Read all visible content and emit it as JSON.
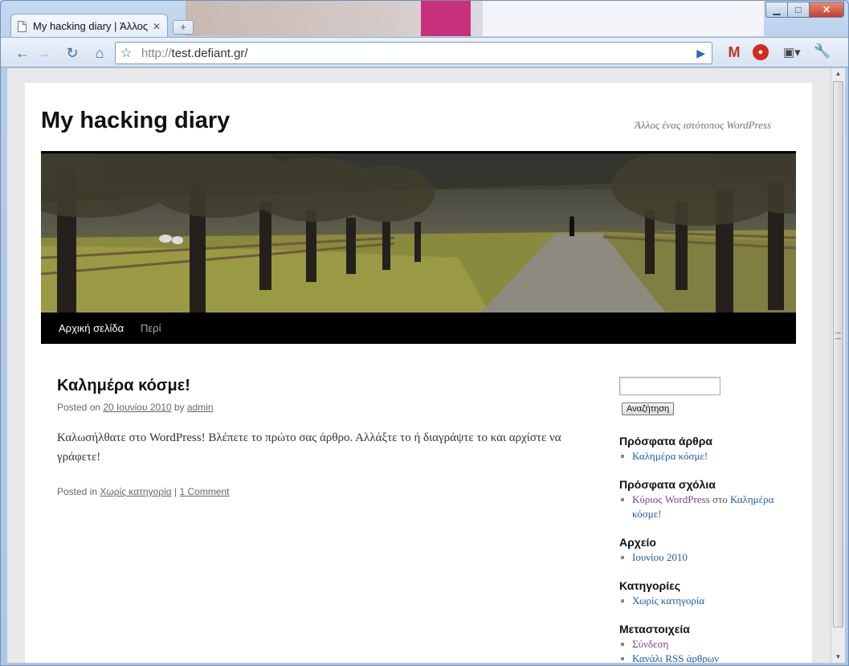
{
  "browser": {
    "tab_title": "My hacking diary | Άλλος...",
    "tab_close": "✕",
    "newtab": "+",
    "url_prefix": "http://",
    "url_host": "test.defiant.gr/",
    "window_buttons": {
      "minimize": "▁",
      "maximize": "□",
      "close": "✕"
    }
  },
  "site": {
    "title": "My hacking diary",
    "tagline": "Άλλος ένας ιστότοπος WordPress",
    "nav": [
      "Αρχική σελίδα",
      "Περί"
    ]
  },
  "post": {
    "title": "Καλημέρα κόσμε!",
    "meta_posted_on": "Posted on ",
    "meta_date": "20 Ιουνίου 2010",
    "meta_by": " by ",
    "meta_author": "admin",
    "content": "Καλωσήλθατε στο WordPress! Βλέπετε το πρώτο σας άρθρο. Αλλάξτε το ή διαγράψτε το και αρχίστε να γράφετε!",
    "footer_posted_in": "Posted in ",
    "footer_category": "Χωρίς κατηγορία",
    "footer_sep": " | ",
    "footer_comments": "1 Comment"
  },
  "sidebar": {
    "search_button": "Αναζήτηση",
    "recent_posts_title": "Πρόσφατα άρθρα",
    "recent_post_1": "Καλημέρα κόσμε!",
    "recent_comments_title": "Πρόσφατα σχόλια",
    "recent_comment_author": "Κύριος WordPress",
    "recent_comment_on": " στο ",
    "recent_comment_post": "Καλημέρα κόσμε!",
    "archives_title": "Αρχείο",
    "archive_1": "Ιουνίου 2010",
    "categories_title": "Κατηγορίες",
    "category_1": "Χωρίς κατηγορία",
    "meta_title": "Μεταστοιχεία",
    "meta_login": "Σύνδεση",
    "meta_rss": "Κανάλι RSS άρθρων"
  }
}
